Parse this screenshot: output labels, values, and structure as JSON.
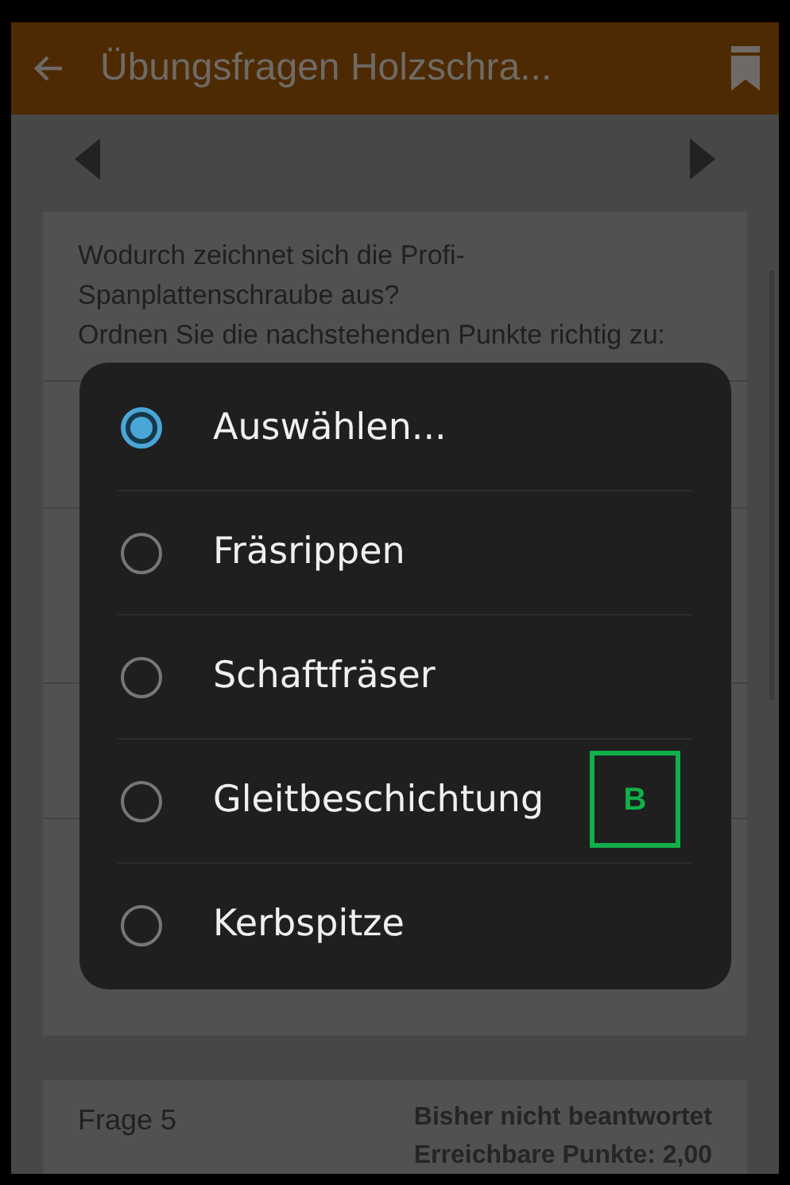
{
  "app_bar": {
    "title": "Übungsfragen Holzschra..."
  },
  "question": {
    "text": "Wodurch zeichnet sich die Profi-Spanplattenschraube aus?",
    "instruction": "Ordnen Sie die nachstehenden Punkte richtig zu:"
  },
  "next_question": {
    "label": "Frage 5",
    "status": "Bisher nicht beantwortet",
    "points": "Erreichbare Punkte: 2,00"
  },
  "dialog": {
    "options": [
      {
        "label": "Auswählen...",
        "selected": true
      },
      {
        "label": "Fräsrippen",
        "selected": false
      },
      {
        "label": "Schaftfräser",
        "selected": false
      },
      {
        "label": "Gleitbeschichtung",
        "selected": false,
        "annotation": {
          "text": "B",
          "color": "#10b04a"
        }
      },
      {
        "label": "Kerbspitze",
        "selected": false
      }
    ]
  }
}
